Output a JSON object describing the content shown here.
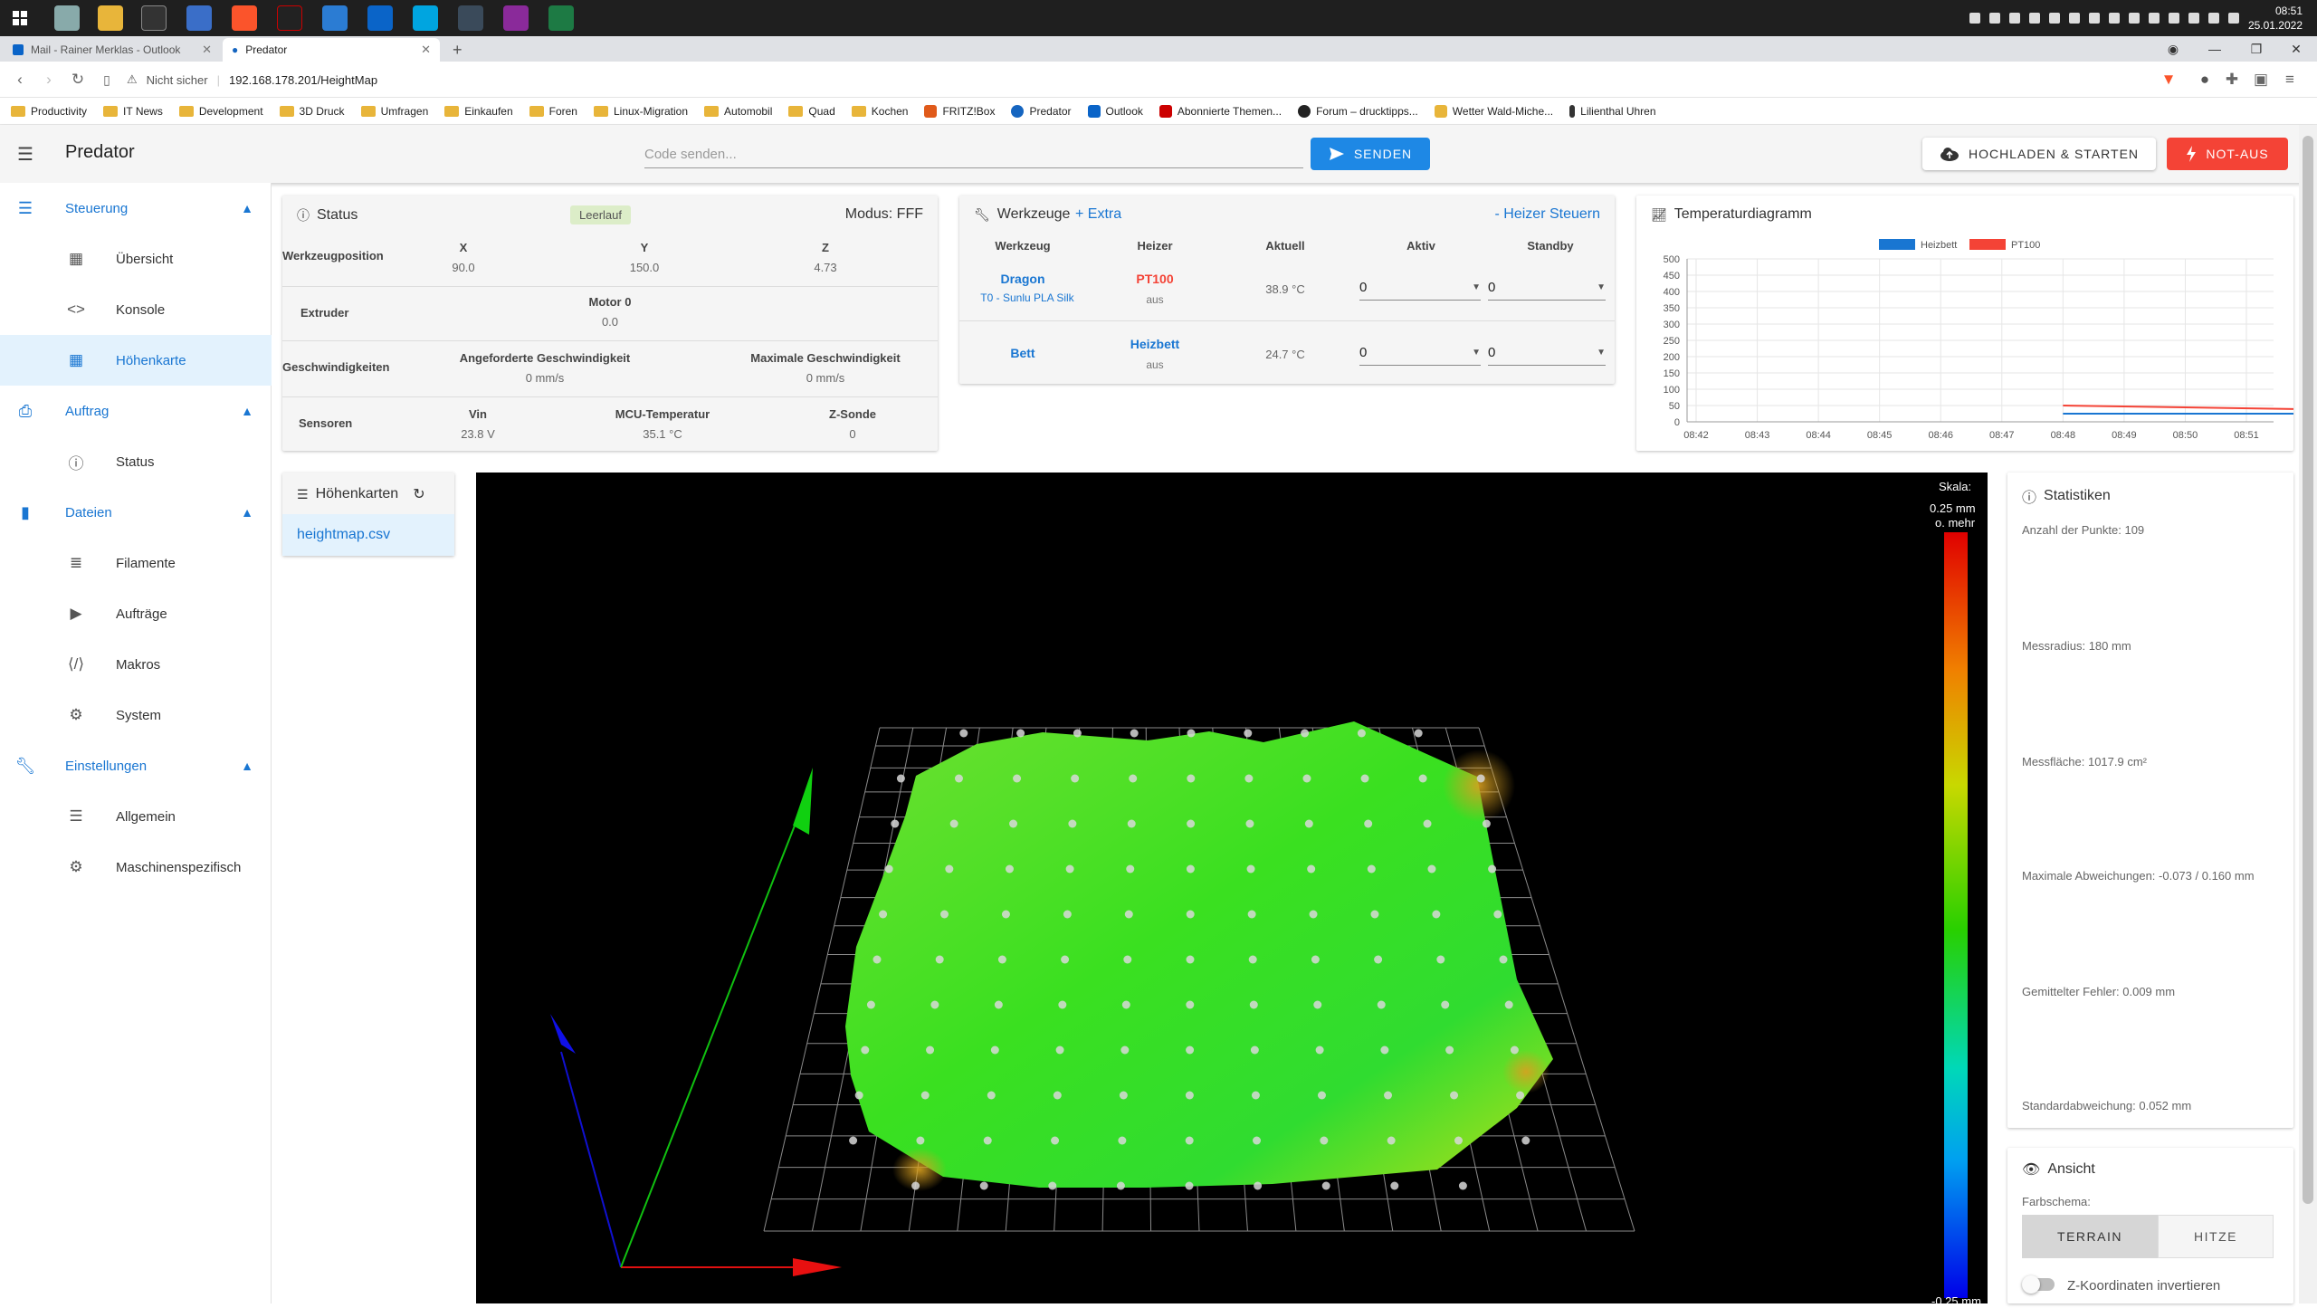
{
  "clock": {
    "time": "08:51",
    "date": "25.01.2022"
  },
  "browser": {
    "tabs": [
      {
        "label": "Mail - Rainer Merklas - Outlook"
      },
      {
        "label": "Predator"
      }
    ],
    "not_secure": "Nicht sicher",
    "url": "192.168.178.201/HeightMap",
    "bookmarks": [
      "Productivity",
      "IT News",
      "Development",
      "3D Druck",
      "Umfragen",
      "Einkaufen",
      "Foren",
      "Linux-Migration",
      "Automobil",
      "Quad",
      "Kochen",
      "FRITZ!Box",
      "Predator",
      "Outlook",
      "Abonnierte Themen...",
      "Forum – drucktipps...",
      "Wetter Wald-Miche...",
      "Lilienthal Uhren"
    ]
  },
  "app": {
    "title": "Predator",
    "code_placeholder": "Code senden...",
    "send_label": "SENDEN",
    "upload_label": "HOCHLADEN & STARTEN",
    "emergency_label": "NOT-AUS"
  },
  "sidebar": {
    "sections": [
      {
        "label": "Steuerung",
        "icon": "sliders-icon"
      },
      {
        "label": "Auftrag",
        "icon": "printer-icon"
      },
      {
        "label": "Dateien",
        "icon": "sd-card-icon"
      },
      {
        "label": "Einstellungen",
        "icon": "wrench-icon"
      }
    ],
    "items": [
      {
        "label": "Übersicht",
        "icon": "dashboard-icon"
      },
      {
        "label": "Konsole",
        "icon": "code-icon"
      },
      {
        "label": "Höhenkarte",
        "icon": "grid-icon"
      },
      {
        "label": "Status",
        "icon": "info-icon"
      },
      {
        "label": "Filamente",
        "icon": "database-icon"
      },
      {
        "label": "Aufträge",
        "icon": "play-icon"
      },
      {
        "label": "Makros",
        "icon": "macro-icon"
      },
      {
        "label": "System",
        "icon": "gear-icon"
      },
      {
        "label": "Allgemein",
        "icon": "tune-icon"
      },
      {
        "label": "Maschinenspezifisch",
        "icon": "cogs-icon"
      }
    ]
  },
  "status": {
    "title": "Status",
    "state": "Leerlauf",
    "mode": "Modus: FFF",
    "tool_position_label": "Werkzeugposition",
    "axes": [
      {
        "name": "X",
        "value": "90.0"
      },
      {
        "name": "Y",
        "value": "150.0"
      },
      {
        "name": "Z",
        "value": "4.73"
      }
    ],
    "extruder_label": "Extruder",
    "motor_label": "Motor 0",
    "motor_value": "0.0",
    "speeds_label": "Geschwindigkeiten",
    "requested_speed_label": "Angeforderte Geschwindigkeit",
    "requested_speed_value": "0 mm/s",
    "max_speed_label": "Maximale Geschwindigkeit",
    "max_speed_value": "0 mm/s",
    "sensors_label": "Sensoren",
    "vin_label": "Vin",
    "vin_value": "23.8 V",
    "mcu_label": "MCU-Temperatur",
    "mcu_value": "35.1 °C",
    "zprobe_label": "Z-Sonde",
    "zprobe_value": "0"
  },
  "tools": {
    "title": "Werkzeuge",
    "extra": "Extra",
    "heater_control": "Heizer Steuern",
    "headers": [
      "Werkzeug",
      "Heizer",
      "Aktuell",
      "Aktiv",
      "Standby"
    ],
    "rows": [
      {
        "name": "Dragon",
        "sub": "T0 - Sunlu PLA Silk",
        "heater": "PT100",
        "heater_state": "aus",
        "current": "38.9 °C",
        "active": "0",
        "standby": "0"
      },
      {
        "name": "Bett",
        "sub": "",
        "heater": "Heizbett",
        "heater_state": "aus",
        "current": "24.7 °C",
        "active": "0",
        "standby": "0"
      }
    ]
  },
  "temp_chart": {
    "title": "Temperaturdiagramm",
    "chart_data": {
      "type": "line",
      "title": "",
      "x": [
        "08:42",
        "08:43",
        "08:44",
        "08:45",
        "08:46",
        "08:47",
        "08:48",
        "08:49",
        "08:50",
        "08:51"
      ],
      "ylim": [
        0,
        500
      ],
      "yticks": [
        0,
        50,
        100,
        150,
        200,
        250,
        300,
        350,
        400,
        450,
        500
      ],
      "grid": true,
      "legend": "top",
      "series": [
        {
          "name": "Heizbett",
          "color": "#1976d2",
          "start": "08:48",
          "points": [
            [
              "08:48",
              25
            ],
            [
              "08:51.9",
              25
            ]
          ]
        },
        {
          "name": "PT100",
          "color": "#f44336",
          "start": "08:48",
          "points": [
            [
              "08:48",
              50
            ],
            [
              "08:51.9",
              39
            ]
          ]
        }
      ]
    }
  },
  "heightmaps": {
    "title": "Höhenkarten",
    "files": [
      "heightmap.csv"
    ]
  },
  "scale": {
    "title": "Skala:",
    "top_value": "0.25 mm",
    "top_suffix": "o. mehr",
    "bottom_value": "-0.25 mm"
  },
  "statistics": {
    "title": "Statistiken",
    "points": "Anzahl der Punkte: 109",
    "radius": "Messradius: 180 mm",
    "area": "Messfläche: 1017.9 cm²",
    "max_dev": "Maximale Abweichungen: -0.073 / 0.160 mm",
    "mean_err": "Gemittelter Fehler: 0.009 mm",
    "std_dev": "Standardabweichung: 0.052 mm"
  },
  "view": {
    "title": "Ansicht",
    "scheme_label": "Farbschema:",
    "terrain": "TERRAIN",
    "heat": "HITZE",
    "invert_label": "Z-Koordinaten invertieren"
  }
}
